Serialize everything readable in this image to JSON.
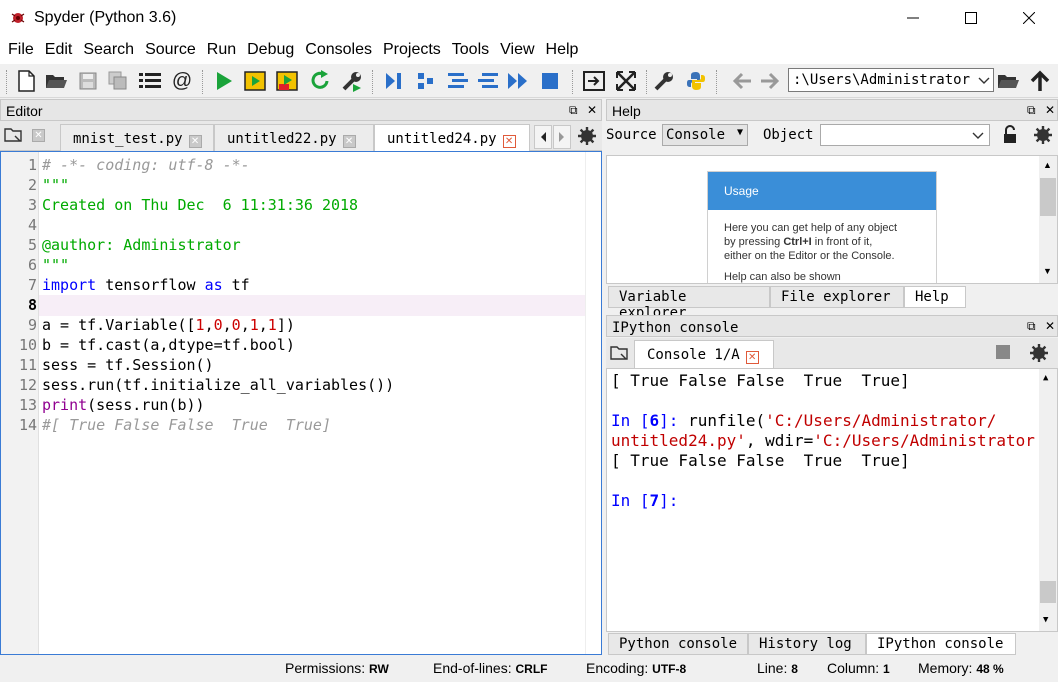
{
  "app": {
    "title": "Spyder (Python 3.6)"
  },
  "menu": [
    "File",
    "Edit",
    "Search",
    "Source",
    "Run",
    "Debug",
    "Consoles",
    "Projects",
    "Tools",
    "View",
    "Help"
  ],
  "toolbar": {
    "path": ":\\Users\\Administrator"
  },
  "editor": {
    "header": "Editor",
    "tabs": [
      {
        "label": "mnist_test.py",
        "active": false
      },
      {
        "label": "untitled22.py",
        "active": false
      },
      {
        "label": "untitled24.py",
        "active": true
      }
    ],
    "current_line": 8,
    "lines": [
      "# -*- coding: utf-8 -*-",
      "\"\"\"",
      "Created on Thu Dec  6 11:31:36 2018",
      "",
      "@author: Administrator",
      "\"\"\"",
      "import tensorflow as tf",
      "",
      "a = tf.Variable([1,0,0,1,1])",
      "b = tf.cast(a,dtype=tf.bool)",
      "sess = tf.Session()",
      "sess.run(tf.initialize_all_variables())",
      "print(sess.run(b))",
      "#[ True False False  True  True]"
    ]
  },
  "help": {
    "header": "Help",
    "source_label": "Source",
    "source_value": "Console",
    "object_label": "Object",
    "usage_title": "Usage",
    "usage_text_1": "Here you can get help of any object",
    "usage_text_2a": "by pressing ",
    "usage_shortcut": "Ctrl+I",
    "usage_text_2b": " in front of it,",
    "usage_text_3": "either on the Editor or the Console.",
    "usage_text_4": "Help can also be shown",
    "tabs": [
      "Variable explorer",
      "File explorer",
      "Help"
    ]
  },
  "console": {
    "header": "IPython console",
    "tab_label": "Console 1/A",
    "output_1": "[ True False False  True  True]",
    "prompt_6_num": "6",
    "runfile_path": "'C:/Users/Administrator/",
    "runfile_path2": "untitled24.py'",
    "wdir": "'C:/Users/Administrator'",
    "output_2": "[ True False False  True  True]",
    "prompt_7_num": "7",
    "tabs": [
      "Python console",
      "History log",
      "IPython console"
    ]
  },
  "status": {
    "permissions_label": "Permissions:",
    "permissions_value": "RW",
    "eol_label": "End-of-lines:",
    "eol_value": "CRLF",
    "encoding_label": "Encoding:",
    "encoding_value": "UTF-8",
    "line_label": "Line:",
    "line_value": "8",
    "column_label": "Column:",
    "column_value": "1",
    "memory_label": "Memory:",
    "memory_value": "48 %"
  },
  "colors": {
    "accent": "#3a7bd5",
    "usage_header": "#3a8ed8",
    "close_red": "#e05a3a"
  }
}
